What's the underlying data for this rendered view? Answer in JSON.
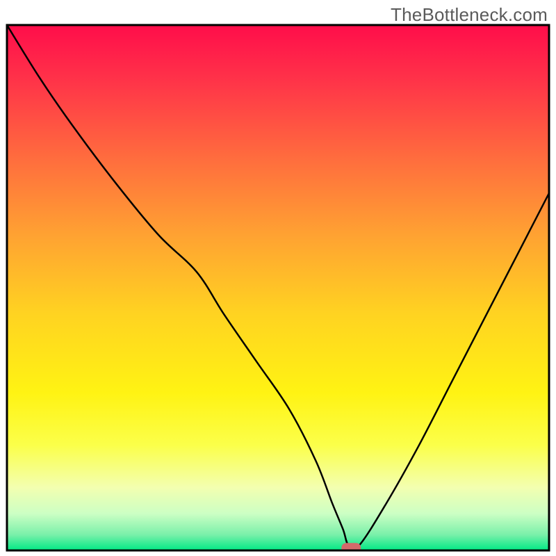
{
  "watermark": "TheBottleneck.com",
  "chart_data": {
    "type": "line",
    "title": "",
    "xlabel": "",
    "ylabel": "",
    "xlim": [
      0,
      100
    ],
    "ylim": [
      0,
      100
    ],
    "series": [
      {
        "name": "bottleneck-curve",
        "x": [
          0,
          6,
          12,
          20,
          28,
          35,
          40,
          46,
          52,
          57,
          60,
          62,
          63,
          65,
          70,
          76,
          82,
          88,
          94,
          100
        ],
        "y": [
          100,
          90,
          81,
          70,
          60,
          53,
          45,
          36,
          27,
          17,
          9,
          4,
          1,
          1,
          9,
          20,
          32,
          44,
          56,
          68
        ]
      }
    ],
    "marker": {
      "name": "current-position",
      "x": 63.5,
      "y": 0.5,
      "color": "#d46a6a"
    },
    "background_gradient": {
      "stops": [
        {
          "offset": 0.0,
          "color": "#ff0d4a"
        },
        {
          "offset": 0.1,
          "color": "#ff3149"
        },
        {
          "offset": 0.25,
          "color": "#ff6b3e"
        },
        {
          "offset": 0.4,
          "color": "#ffa232"
        },
        {
          "offset": 0.55,
          "color": "#ffd321"
        },
        {
          "offset": 0.7,
          "color": "#fff313"
        },
        {
          "offset": 0.8,
          "color": "#fbff4a"
        },
        {
          "offset": 0.88,
          "color": "#f3ffb0"
        },
        {
          "offset": 0.93,
          "color": "#ccffc4"
        },
        {
          "offset": 0.97,
          "color": "#7af0aa"
        },
        {
          "offset": 1.0,
          "color": "#00e884"
        }
      ]
    },
    "border_color": "#000000",
    "border_width": 3
  }
}
